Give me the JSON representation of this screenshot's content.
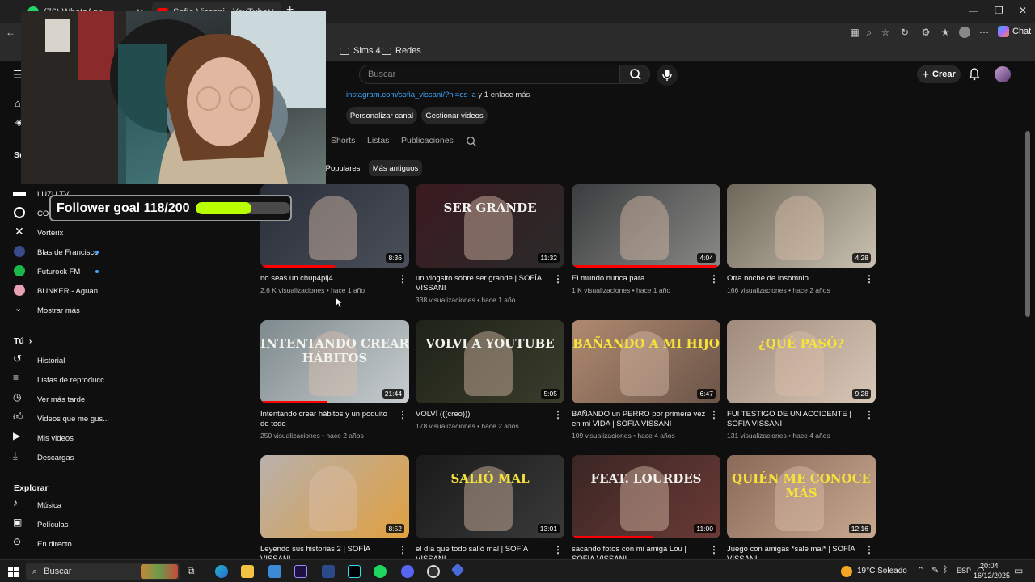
{
  "browser": {
    "tabs": [
      {
        "label": "(76) WhatsApp"
      },
      {
        "label": "Sofía Vissani - YouTube"
      }
    ],
    "new_tab": "+",
    "bookmarks": [
      {
        "label": "Sims 4"
      },
      {
        "label": "Redes"
      }
    ],
    "copilot_label": "Chat"
  },
  "youtube": {
    "search_placeholder": "Buscar",
    "create_label": "Crear",
    "channel": {
      "link_text": "instagram.com/sofia_vissani/?hl=es-la",
      "link_suffix": "y 1 enlace más",
      "buttons": [
        "Personalizar canal",
        "Gestionar videos"
      ],
      "tabs": [
        "Shorts",
        "Listas",
        "Publicaciones"
      ],
      "chips": [
        "Populares",
        "Más antiguos"
      ]
    },
    "sidebar": {
      "subscriptions_head": "Su",
      "subscriptions": [
        {
          "label": "LUZU TV",
          "dot": false
        },
        {
          "label": "COL",
          "dot": false
        },
        {
          "label": "Vorterix",
          "dot": false
        },
        {
          "label": "Blas de Francisco",
          "dot": true
        },
        {
          "label": "Futurock FM",
          "dot": true
        },
        {
          "label": "BUNKER - Aguan...",
          "dot": false
        }
      ],
      "show_more": "Mostrar más",
      "you_head": "Tú",
      "you_items": [
        {
          "label": "Historial",
          "icon": "history-icon"
        },
        {
          "label": "Listas de reproducc...",
          "icon": "playlist-icon"
        },
        {
          "label": "Ver más tarde",
          "icon": "clock-icon"
        },
        {
          "label": "Videos que me gus...",
          "icon": "like-icon"
        },
        {
          "label": "Mis videos",
          "icon": "my-videos-icon"
        },
        {
          "label": "Descargas",
          "icon": "download-icon"
        }
      ],
      "explore_head": "Explorar",
      "explore_items": [
        {
          "label": "Música",
          "icon": "music-icon"
        },
        {
          "label": "Películas",
          "icon": "movies-icon"
        },
        {
          "label": "En directo",
          "icon": "live-icon"
        }
      ]
    },
    "videos": [
      {
        "title": "no seas un chup4pij4",
        "meta": "2,6 K visualizaciones • hace 1 año",
        "duration": "8:36",
        "progress": 0.5,
        "thumb_text": "",
        "colors": [
          "#2a2f3a",
          "#4a4f5a"
        ]
      },
      {
        "title": "un vlogsito sobre ser grande | SOFÍA VISSANI",
        "meta": "338 visualizaciones • hace 1 año",
        "duration": "11:32",
        "progress": 0.0,
        "thumb_text": "SER GRANDE",
        "colors": [
          "#3a1a1f",
          "#2a2a2a"
        ]
      },
      {
        "title": "El mundo nunca para",
        "meta": "1 K visualizaciones • hace 1 año",
        "duration": "4:04",
        "progress": 0.98,
        "thumb_text": "",
        "colors": [
          "#3a3c3e",
          "#8a8a86"
        ]
      },
      {
        "title": "Otra noche de insomnio",
        "meta": "166 visualizaciones • hace 2 años",
        "duration": "4:28",
        "progress": 0.0,
        "thumb_text": "",
        "colors": [
          "#6e6658",
          "#c9c2b2"
        ]
      },
      {
        "title": "Intentando crear hábitos y un poquito de todo",
        "meta": "250 visualizaciones • hace 2 años",
        "duration": "21:44",
        "progress": 0.45,
        "thumb_text": "INTENTANDO CREAR HÁBITOS",
        "colors": [
          "#7e8a8e",
          "#c8cdcf"
        ]
      },
      {
        "title": "VOLVÍ (((creo)))",
        "meta": "178 visualizaciones • hace 2 años",
        "duration": "5:05",
        "progress": 0.0,
        "thumb_text": "VOLVI A YOUTUBE",
        "colors": [
          "#1f2218",
          "#3a3d2c"
        ]
      },
      {
        "title": "BAÑANDO un PERRO por primera vez en mi VIDA | SOFÍA VISSANI",
        "meta": "109 visualizaciones • hace 4 años",
        "duration": "6:47",
        "progress": 0.0,
        "thumb_text": "BAÑANDO A MI HIJO",
        "colors": [
          "#b08a70",
          "#6a5448"
        ]
      },
      {
        "title": "FUI TESTIGO DE UN ACCIDENTE | SOFÍA VISSANI",
        "meta": "131 visualizaciones • hace 4 años",
        "duration": "9:28",
        "progress": 0.0,
        "thumb_text": "¿QUÉ PASÓ?",
        "colors": [
          "#a08a7c",
          "#d8c8b8"
        ]
      },
      {
        "title": "Leyendo sus historias 2 | SOFÍA VISSANI",
        "meta": "",
        "duration": "8:52",
        "progress": 0.0,
        "thumb_text": "",
        "colors": [
          "#b8b0ac",
          "#e0a040"
        ]
      },
      {
        "title": "el día que todo salió mal | SOFÍA VISSANI",
        "meta": "",
        "duration": "13:01",
        "progress": 0.0,
        "thumb_text": "SALIÓ MAL",
        "colors": [
          "#1a1a1a",
          "#3a3a3a"
        ]
      },
      {
        "title": "sacando fotos con mi amiga Lou | SOFÍA VISSANI",
        "meta": "",
        "duration": "11:00",
        "progress": 0.55,
        "thumb_text": "FEAT. LOURDES",
        "colors": [
          "#3a2624",
          "#6a3a36"
        ]
      },
      {
        "title": "Juego con amigas *sale mal* | SOFÍA VISSANI",
        "meta": "",
        "duration": "12:16",
        "progress": 0.0,
        "thumb_text": "QUIÉN ME CONOCE MÁS",
        "colors": [
          "#8a6a58",
          "#c8a890"
        ]
      }
    ]
  },
  "stream_overlay": {
    "follower_goal_text": "Follower goal 118/200",
    "follower_goal_fraction": 0.59
  },
  "taskbar": {
    "search_placeholder": "Buscar",
    "weather": "19°C Soleado",
    "lang": "ESP",
    "time": "20:04",
    "date": "16/12/2025"
  }
}
